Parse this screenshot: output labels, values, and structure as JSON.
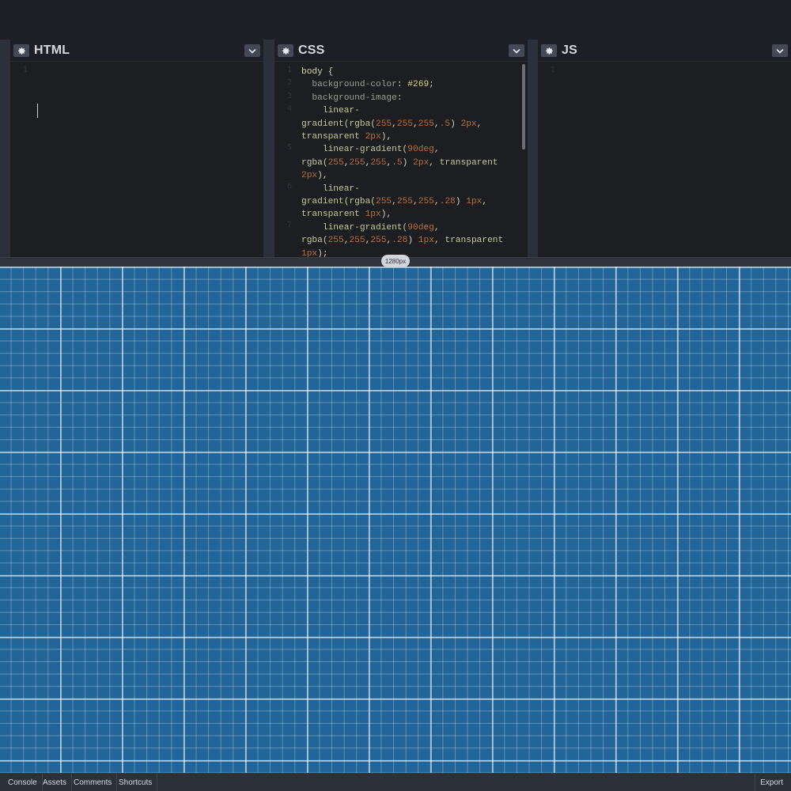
{
  "editors": {
    "html": {
      "title": "HTML",
      "line_numbers": [
        "1"
      ]
    },
    "css": {
      "title": "CSS",
      "line_numbers": [
        "1",
        "2",
        "3",
        "4",
        "5",
        "6",
        "7"
      ]
    },
    "js": {
      "title": "JS",
      "line_numbers": [
        "1"
      ]
    }
  },
  "resizer": {
    "width_label": "1280px"
  },
  "preview": {
    "background_color": "#269",
    "grid_major_color": "rgba(255,255,255,.5)",
    "grid_minor_color": "rgba(255,255,255,.28)"
  },
  "footer": {
    "console": "Console",
    "assets": "Assets",
    "comments": "Comments",
    "shortcuts": "Shortcuts",
    "export": "Export"
  },
  "icons": {
    "settings": "gear-icon",
    "collapse": "chevron-down-icon"
  },
  "css_code": {
    "l1_sel": "body",
    "l1_brace": " {",
    "l2_prop": "  background-color",
    "l2_colon": ": ",
    "l2_val": "#269",
    "l2_end": ";",
    "l3_prop": "  background-image",
    "l3_colon": ":",
    "l4a": "    linear-",
    "l4b_fn": "gradient(rgba(",
    "l4b_n1": "255",
    "l4b_c1": ",",
    "l4b_n2": "255",
    "l4b_c2": ",",
    "l4b_n3": "255",
    "l4b_c3": ",",
    "l4b_n4": ".5",
    "l4b_p": ") ",
    "l4b_n5": "2px",
    "l4b_end": ",",
    "l4c_kw": "transparent ",
    "l4c_n": "2px",
    "l4c_end": "),",
    "l5a_fn": "    linear-gradient(",
    "l5a_n": "90deg",
    "l5a_end": ",",
    "l5b_fn": "rgba(",
    "l5b_n1": "255",
    "l5b_c1": ",",
    "l5b_n2": "255",
    "l5b_c2": ",",
    "l5b_n3": "255",
    "l5b_c3": ",",
    "l5b_n4": ".5",
    "l5b_p": ") ",
    "l5b_n5": "2px",
    "l5b_kw": ", transparent",
    "l5c_n": "2px",
    "l5c_end": "),",
    "l6a": "    linear-",
    "l6b_fn": "gradient(rgba(",
    "l6b_n1": "255",
    "l6b_c1": ",",
    "l6b_n2": "255",
    "l6b_c2": ",",
    "l6b_n3": "255",
    "l6b_c3": ",",
    "l6b_n4": ".28",
    "l6b_p": ") ",
    "l6b_n5": "1px",
    "l6b_end": ",",
    "l6c_kw": "transparent ",
    "l6c_n": "1px",
    "l6c_end": "),",
    "l7a_fn": "    linear-gradient(",
    "l7a_n": "90deg",
    "l7a_end": ",",
    "l7b_fn": "rgba(",
    "l7b_n1": "255",
    "l7b_c1": ",",
    "l7b_n2": "255",
    "l7b_c2": ",",
    "l7b_n3": "255",
    "l7b_c3": ",",
    "l7b_n4": ".28",
    "l7b_p": ") ",
    "l7b_n5": "1px",
    "l7b_kw": ", transparent",
    "l7c_n": "1px",
    "l7c_end": ");"
  }
}
